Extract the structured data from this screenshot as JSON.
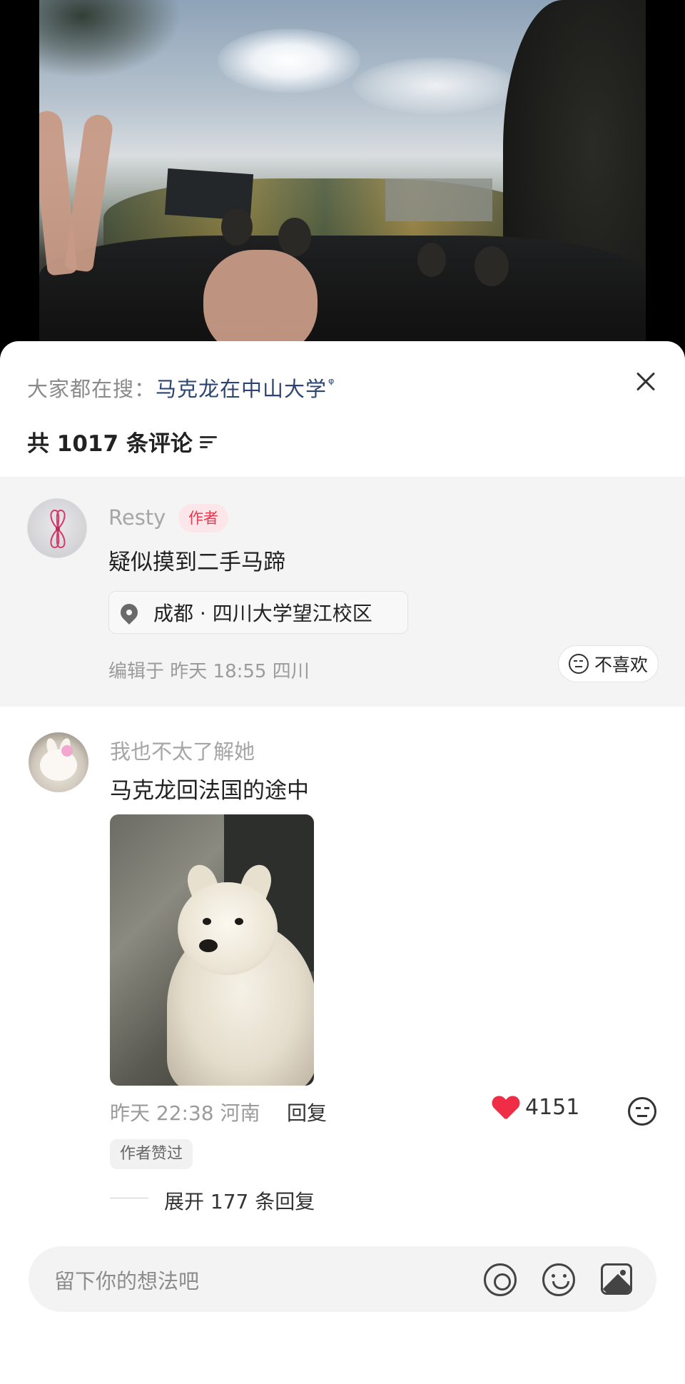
{
  "trending": {
    "prefix": "大家都在搜：",
    "term": "马克龙在中山大学",
    "search_glyph": "ᵠ"
  },
  "comments_header": {
    "count_text": "共 1017 条评论"
  },
  "comment_author": {
    "name": "Resty",
    "badge": "作者",
    "text": "疑似摸到二手马蹄",
    "location": "成都 · 四川大学望江校区",
    "meta": "编辑于  昨天 18:55  四川",
    "dislike_label": "不喜欢"
  },
  "comment_2": {
    "name": "我也不太了解她",
    "text": "马克龙回法国的途中",
    "meta": "昨天 22:38 河南",
    "reply_label": "回复",
    "likes": "4151",
    "author_liked": "作者赞过",
    "expand_label": "展开 177 条回复"
  },
  "input_bar": {
    "placeholder": "留下你的想法吧"
  },
  "icons": {
    "close": "close-icon",
    "sort": "sort-icon",
    "location": "location-pin-icon",
    "dislike": "neutral-face-icon",
    "like": "heart-icon",
    "mention": "at-icon",
    "emoji": "smiley-icon",
    "image": "image-icon"
  },
  "colors": {
    "accent_red": "#ef2d47",
    "badge_bg": "#fce6ea",
    "search_term": "#2b4470",
    "highlight_bg": "#f4f4f5"
  }
}
